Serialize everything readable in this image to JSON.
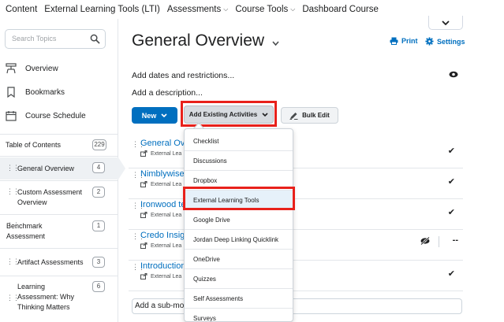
{
  "topnav": {
    "items": [
      {
        "label": "Content",
        "has_chevron": false
      },
      {
        "label": "External Learning Tools (LTI)",
        "has_chevron": false
      },
      {
        "label": "Assessments",
        "has_chevron": true
      },
      {
        "label": "Course Tools",
        "has_chevron": true
      },
      {
        "label": "Dashboard Course",
        "has_chevron": false
      }
    ]
  },
  "sidebar": {
    "search_placeholder": "Search Topics",
    "links": [
      {
        "label": "Overview",
        "icon": "overview-icon"
      },
      {
        "label": "Bookmarks",
        "icon": "bookmark-icon"
      },
      {
        "label": "Course Schedule",
        "icon": "calendar-icon"
      }
    ],
    "toc": {
      "label": "Table of Contents",
      "count": "229"
    },
    "modules": [
      {
        "label": "General Overview",
        "count": "4",
        "active": true
      },
      {
        "label": "Custom Assessment Overview",
        "count": "2",
        "active": false
      },
      {
        "label": "Benchmark Assessment",
        "count": "1",
        "active": false
      },
      {
        "label": "Artifact Assessments",
        "count": "3",
        "active": false
      },
      {
        "label": "Learning Assessment: Why Thinking Matters",
        "count": "6",
        "active": false
      }
    ]
  },
  "main": {
    "title": "General Overview",
    "print_label": "Print",
    "settings_label": "Settings",
    "add_dates": "Add dates and restrictions...",
    "add_description": "Add a description...",
    "new_label": "New",
    "add_existing_label": "Add Existing Activities",
    "bulk_edit_label": "Bulk Edit",
    "topics": [
      {
        "title": "General Ove",
        "sub": "External Lea",
        "status": "check"
      },
      {
        "title": "Nimblywise T",
        "sub": "External Lea",
        "status": "check"
      },
      {
        "title": "Ironwood te",
        "sub": "External Lea",
        "status": "check"
      },
      {
        "title": "Credo Insigh",
        "sub": "External Lea",
        "status": "hidden",
        "dash": "--"
      },
      {
        "title": "Introduction",
        "sub": "External Lea",
        "status": "check"
      }
    ],
    "submodule_text": "Add a sub-mod"
  },
  "dropdown": {
    "items": [
      {
        "label": "Checklist"
      },
      {
        "label": "Discussions"
      },
      {
        "label": "Dropbox"
      },
      {
        "label": "External Learning Tools",
        "selected": true
      },
      {
        "label": "Google Drive"
      },
      {
        "label": "Jordan Deep Linking Quicklink"
      },
      {
        "label": "OneDrive"
      },
      {
        "label": "Quizzes"
      },
      {
        "label": "Self Assessments"
      },
      {
        "label": "Surveys"
      }
    ]
  },
  "colors": {
    "accent": "#006fbf",
    "highlight_frame": "#e8211b",
    "selected_bg": "#e6f1fa"
  }
}
